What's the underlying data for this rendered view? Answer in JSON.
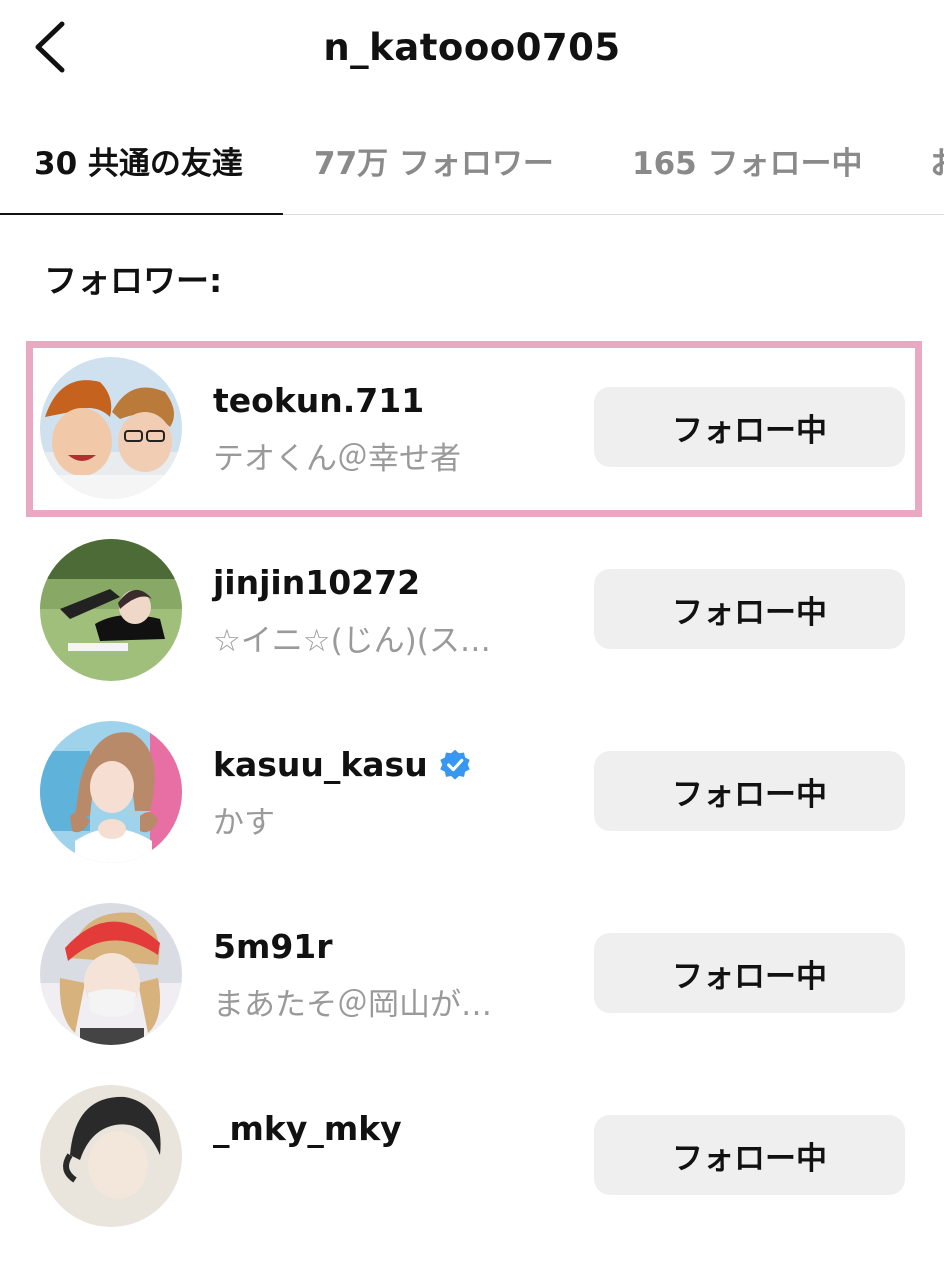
{
  "header": {
    "title": "n_katooo0705"
  },
  "tabs": [
    {
      "label": "30 共通の友達"
    },
    {
      "label": "77万 フォロワー"
    },
    {
      "label": "165 フォロー中"
    },
    {
      "label": "お"
    }
  ],
  "section": {
    "label": "フォロワー:"
  },
  "users": [
    {
      "username": "teokun.711",
      "name": "テオくん＠幸せ者",
      "button": "フォロー中",
      "verified": false
    },
    {
      "username": "jinjin10272",
      "name": "☆イニ☆(じん)(ス…",
      "button": "フォロー中",
      "verified": false
    },
    {
      "username": "kasuu_kasu",
      "name": "かす",
      "button": "フォロー中",
      "verified": true
    },
    {
      "username": "5m91r",
      "name": "まあたそ＠岡山が…",
      "button": "フォロー中",
      "verified": false
    },
    {
      "username": "_mky_mky",
      "name": "",
      "button": "フォロー中",
      "verified": false
    }
  ],
  "colors": {
    "highlight": "#e9a9c2",
    "verified": "#3897f0",
    "button_bg": "#efefef",
    "secondary_text": "#9a9a9a"
  }
}
